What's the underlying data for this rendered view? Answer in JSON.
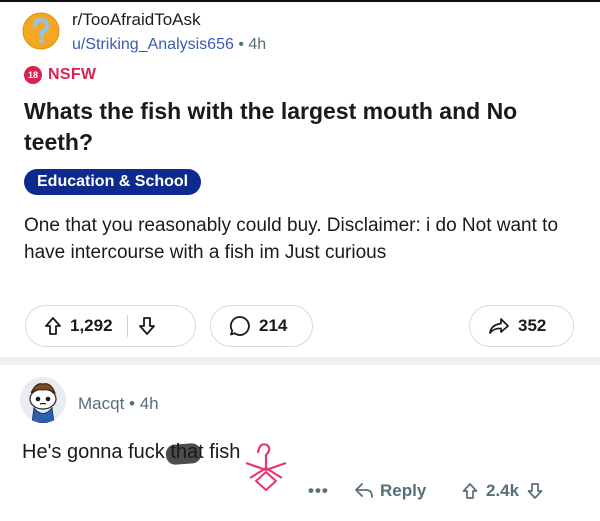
{
  "post": {
    "subreddit": "r/TooAfraidToAsk",
    "author": "u/Striking_Analysis656",
    "separator": "•",
    "age": "4h",
    "nsfw_badge": "18",
    "nsfw_label": "NSFW",
    "title": "Whats the fish with the largest mouth and No teeth?",
    "flair": "Education & School",
    "flair_color": "#0e2a8f",
    "body": "One that you reasonably could buy. Disclaimer: i do Not want to have intercourse with a fish im Just curious",
    "upvotes": "1,292",
    "comments": "214",
    "shares": "352",
    "icons": {
      "subreddit": "question-mark-icon",
      "upvote": "arrow-up-icon",
      "downvote": "arrow-down-icon",
      "comment": "speech-bubble-icon",
      "share": "share-arrow-icon"
    }
  },
  "comment": {
    "author": "Macqt",
    "separator": "•",
    "age": "4h",
    "body": "He's gonna fuck that fish",
    "more": "•••",
    "reply_label": "Reply",
    "votes": "2.4k"
  },
  "colors": {
    "nsfw": "#d9234f",
    "meta_text": "#576f76",
    "link": "#3b5bb5",
    "doodle": "#e8356f"
  }
}
